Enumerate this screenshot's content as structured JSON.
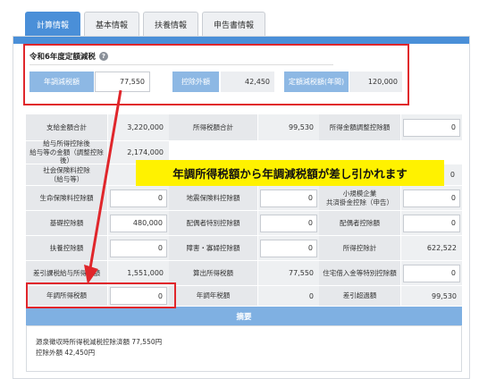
{
  "tabs": [
    "計算情報",
    "基本情報",
    "扶養情報",
    "申告書情報"
  ],
  "section_title": "令和6年度定額減税",
  "help_icon": "?",
  "top_row": [
    {
      "label": "年調減税額",
      "value": "77,550",
      "style": "white"
    },
    {
      "label": "控除外額",
      "value": "42,450",
      "style": "grey"
    },
    {
      "label": "定額減税額(年間)",
      "value": "120,000",
      "style": "grey"
    }
  ],
  "grid_rows": [
    [
      {
        "label": "支給金額合計",
        "value": "3,220,000",
        "style": "plain"
      },
      {
        "label": "所得税額合計",
        "value": "99,530",
        "style": "plain"
      },
      {
        "label": "所得金額調整控除額",
        "value": "0",
        "style": "box"
      }
    ],
    [
      {
        "label": "給与所得控除後\n給与等の金額（調整控除後）",
        "value": "2,174,000",
        "style": "plain"
      },
      {
        "label": "",
        "value": "",
        "style": "none"
      },
      {
        "label": "",
        "value": "",
        "style": "none"
      }
    ],
    [
      {
        "label": "社会保険料控除\n（給与等）",
        "value": "",
        "style": "box"
      },
      {
        "label": "",
        "value": "",
        "style": "none"
      },
      {
        "label": "",
        "value": "0",
        "style": "box"
      }
    ],
    [
      {
        "label": "生命保険料控除額",
        "value": "0",
        "style": "box"
      },
      {
        "label": "地震保険料控除額",
        "value": "0",
        "style": "box"
      },
      {
        "label": "小規模企業\n共済掛金控除（申告）",
        "value": "0",
        "style": "box"
      }
    ],
    [
      {
        "label": "基礎控除額",
        "value": "480,000",
        "style": "box"
      },
      {
        "label": "配偶者特別控除額",
        "value": "0",
        "style": "box"
      },
      {
        "label": "配偶者控除額",
        "value": "0",
        "style": "box"
      }
    ],
    [
      {
        "label": "扶養控除額",
        "value": "0",
        "style": "box"
      },
      {
        "label": "障害・寡婦控除額",
        "value": "0",
        "style": "box"
      },
      {
        "label": "所得控除計",
        "value": "622,522",
        "style": "plain"
      }
    ],
    [
      {
        "label": "差引課税給与所得金額",
        "value": "1,551,000",
        "style": "plain"
      },
      {
        "label": "算出所得税額",
        "value": "77,550",
        "style": "plain"
      },
      {
        "label": "住宅借入金等特別控除額",
        "value": "0",
        "style": "box"
      }
    ],
    [
      {
        "label": "年調所得税額",
        "value": "0",
        "style": "box"
      },
      {
        "label": "年調年税額",
        "value": "0",
        "style": "plain"
      },
      {
        "label": "差引超過額",
        "value": "99,530",
        "style": "plain"
      }
    ]
  ],
  "summary_title": "摘要",
  "summary_lines": [
    "源泉徴収時所得税減税控除済額 77,550円",
    "控除外額 42,450円"
  ],
  "callout": "年調所得税額から年調減税額が差し引かれます",
  "colors": {
    "accent": "#4a8fd8",
    "annotation_red": "#e0262b",
    "callout_yellow": "#fff200"
  }
}
